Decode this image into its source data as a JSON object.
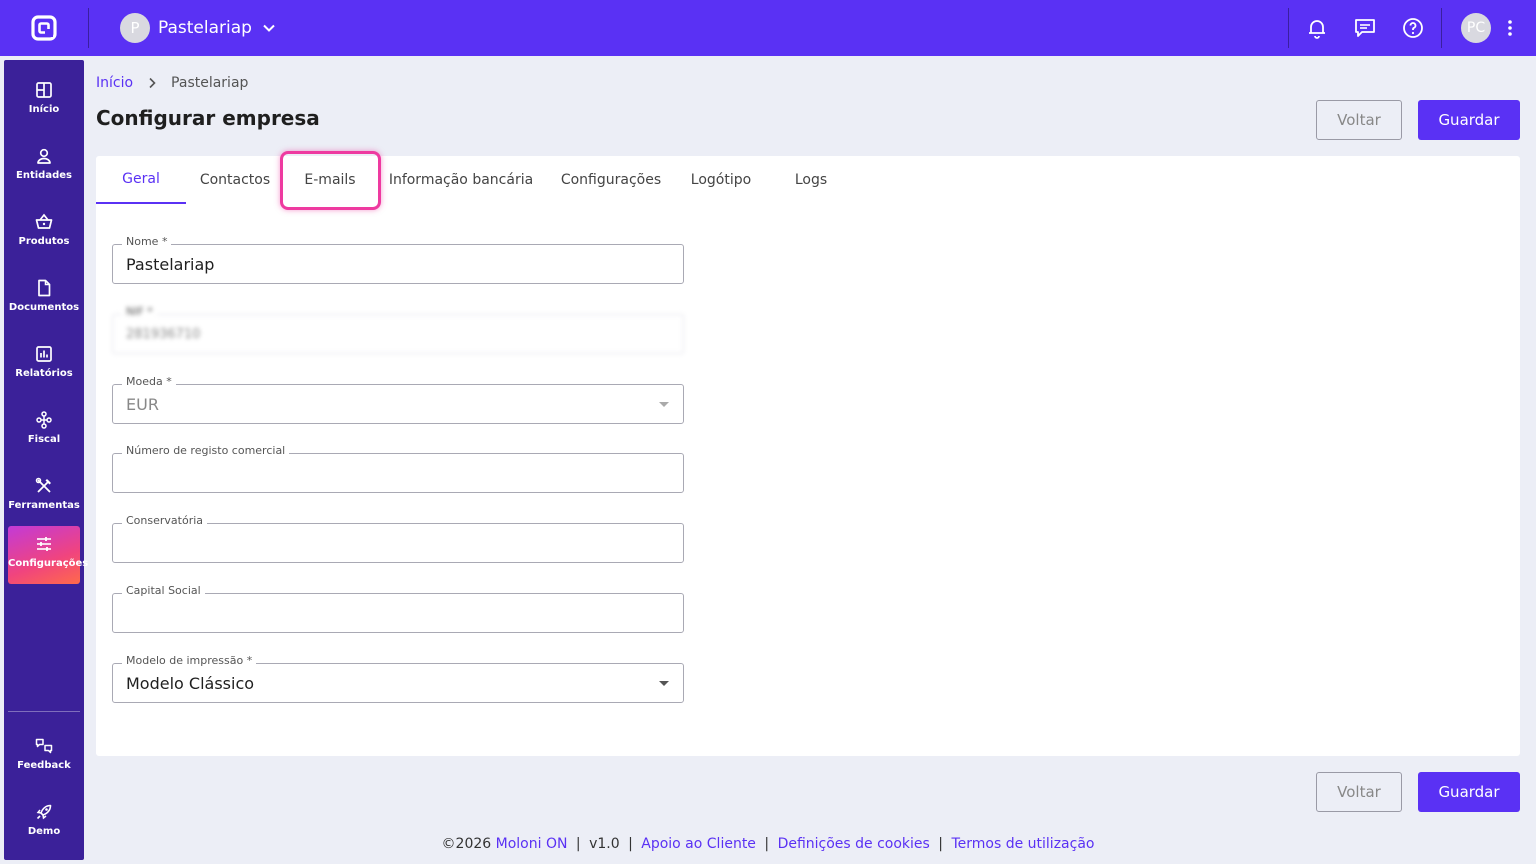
{
  "topbar": {
    "company_initial": "P",
    "company_name": "Pastelariap",
    "user_initials": "PC",
    "bg_color": "#5a31f4"
  },
  "sidebar": {
    "items": [
      {
        "label": "Início",
        "icon": "grid-icon"
      },
      {
        "label": "Entidades",
        "icon": "person-icon"
      },
      {
        "label": "Produtos",
        "icon": "basket-icon"
      },
      {
        "label": "Documentos",
        "icon": "document-icon"
      },
      {
        "label": "Relatórios",
        "icon": "chart-icon"
      },
      {
        "label": "Fiscal",
        "icon": "hierarchy-icon"
      },
      {
        "label": "Ferramentas",
        "icon": "tools-icon"
      },
      {
        "label": "Configurações",
        "icon": "sliders-icon",
        "active": true
      }
    ],
    "bottom_items": [
      {
        "label": "Feedback",
        "icon": "feedback-icon"
      },
      {
        "label": "Demo",
        "icon": "rocket-icon"
      }
    ]
  },
  "breadcrumb": {
    "home": "Início",
    "current": "Pastelariap"
  },
  "page": {
    "title": "Configurar empresa",
    "back_label": "Voltar",
    "save_label": "Guardar"
  },
  "tabs": [
    {
      "label": "Geral",
      "active": true
    },
    {
      "label": "Contactos"
    },
    {
      "label": "E-mails",
      "highlighted": true
    },
    {
      "label": "Informação bancária"
    },
    {
      "label": "Configurações"
    },
    {
      "label": "Logótipo"
    },
    {
      "label": "Logs"
    }
  ],
  "form": {
    "nome": {
      "label": "Nome *",
      "value": "Pastelariap"
    },
    "nif": {
      "label": "NIF *",
      "value": "281936710"
    },
    "moeda": {
      "label": "Moeda *",
      "value": "EUR"
    },
    "registo": {
      "label": "Número de registo comercial",
      "value": ""
    },
    "conservatoria": {
      "label": "Conservatória",
      "value": ""
    },
    "capital": {
      "label": "Capital Social",
      "value": ""
    },
    "modelo": {
      "label": "Modelo de impressão *",
      "value": "Modelo Clássico"
    }
  },
  "footer": {
    "copyright": "©2026",
    "brand": "Moloni ON",
    "version": "v1.0",
    "support": "Apoio ao Cliente",
    "cookies": "Definições de cookies",
    "terms": "Termos de utilização"
  },
  "colors": {
    "accent": "#5a31f4",
    "sidebar": "#3b2199",
    "highlight": "#ee3aa0",
    "background": "#eceef6"
  }
}
